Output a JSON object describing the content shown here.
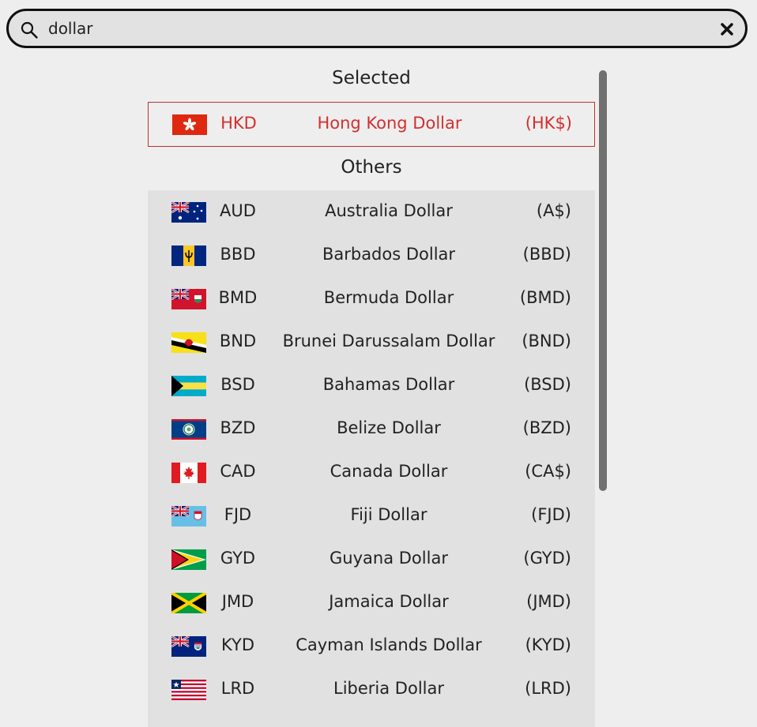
{
  "search": {
    "value": "dollar",
    "placeholder": ""
  },
  "sections": {
    "selected_title": "Selected",
    "others_title": "Others"
  },
  "selected": {
    "code": "HKD",
    "name": "Hong Kong Dollar",
    "symbol": "(HK$)",
    "flag": "hk-flag-icon"
  },
  "others": [
    {
      "code": "AUD",
      "name": "Australia Dollar",
      "symbol": "(A$)",
      "flag": "au-flag-icon"
    },
    {
      "code": "BBD",
      "name": "Barbados Dollar",
      "symbol": "(BBD)",
      "flag": "bb-flag-icon"
    },
    {
      "code": "BMD",
      "name": "Bermuda Dollar",
      "symbol": "(BMD)",
      "flag": "bm-flag-icon"
    },
    {
      "code": "BND",
      "name": "Brunei Darussalam Dollar",
      "symbol": "(BND)",
      "flag": "bn-flag-icon"
    },
    {
      "code": "BSD",
      "name": "Bahamas Dollar",
      "symbol": "(BSD)",
      "flag": "bs-flag-icon"
    },
    {
      "code": "BZD",
      "name": "Belize Dollar",
      "symbol": "(BZD)",
      "flag": "bz-flag-icon"
    },
    {
      "code": "CAD",
      "name": "Canada Dollar",
      "symbol": "(CA$)",
      "flag": "ca-flag-icon"
    },
    {
      "code": "FJD",
      "name": "Fiji Dollar",
      "symbol": "(FJD)",
      "flag": "fj-flag-icon"
    },
    {
      "code": "GYD",
      "name": "Guyana Dollar",
      "symbol": "(GYD)",
      "flag": "gy-flag-icon"
    },
    {
      "code": "JMD",
      "name": "Jamaica Dollar",
      "symbol": "(JMD)",
      "flag": "jm-flag-icon"
    },
    {
      "code": "KYD",
      "name": "Cayman Islands Dollar",
      "symbol": "(KYD)",
      "flag": "ky-flag-icon"
    },
    {
      "code": "LRD",
      "name": "Liberia Dollar",
      "symbol": "(LRD)",
      "flag": "lr-flag-icon"
    }
  ],
  "colors": {
    "selected_accent": "#d32f2f",
    "list_background": "#e1e1e1",
    "page_background": "#eeeeee"
  }
}
